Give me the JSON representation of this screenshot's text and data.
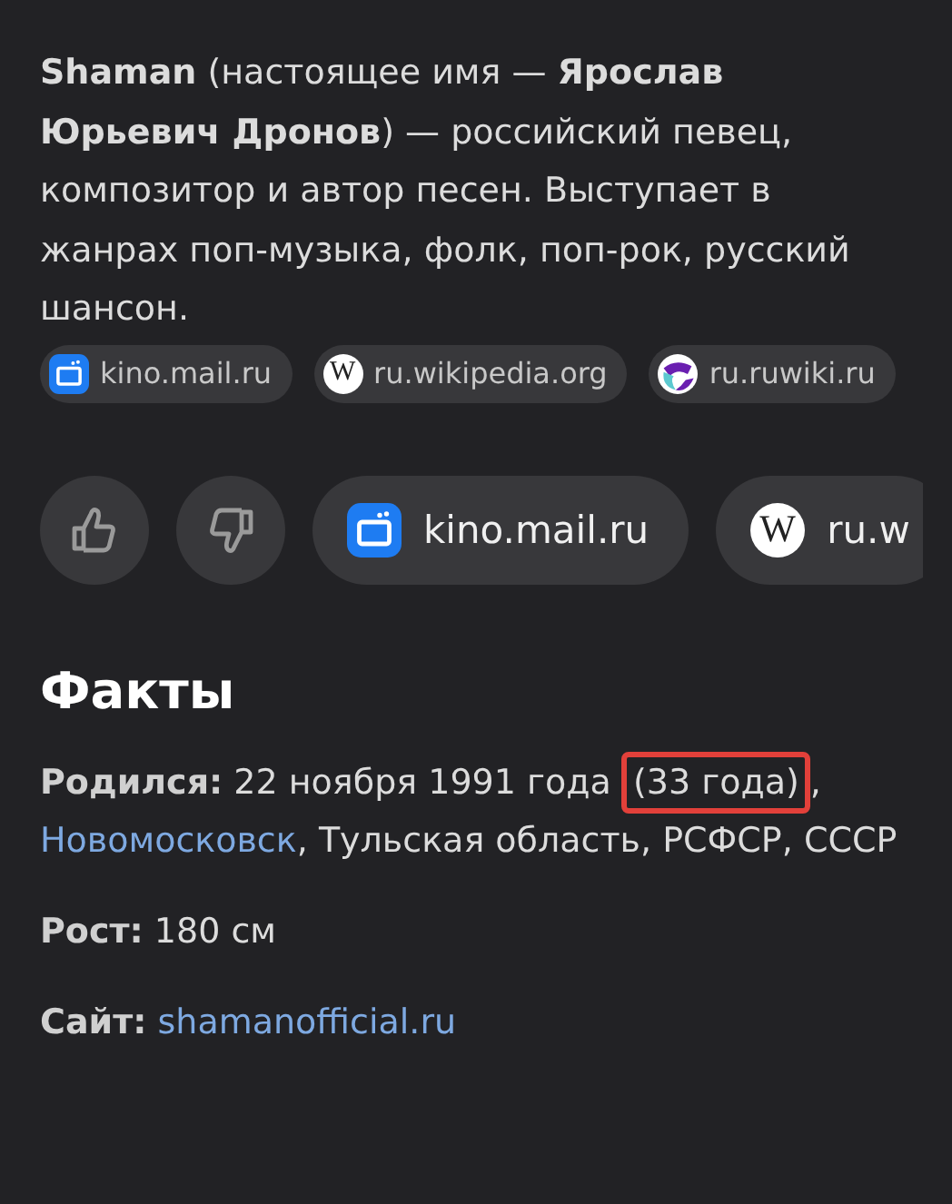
{
  "description": "**Shaman** (настоящее имя — **Ярослав Юрьевич Дронов**) — российский певец, композитор и автор песен. Выступает в жанрах поп-музыка, фолк, поп-рок, русский шансон.",
  "sources": [
    {
      "label": "kino.mail.ru",
      "kind": "kino"
    },
    {
      "label": "ru.wikipedia.org",
      "kind": "wiki",
      "glyph": "W"
    },
    {
      "label": "ru.ruwiki.ru",
      "kind": "ruwiki"
    }
  ],
  "actions": {
    "feedback": [
      {
        "kind": "like"
      },
      {
        "kind": "dislike"
      }
    ],
    "links": [
      {
        "label": "kino.mail.ru",
        "kind": "kino"
      },
      {
        "label": "ru.w",
        "kind": "wiki",
        "glyph": "W"
      }
    ]
  },
  "facts": {
    "title": "Факты",
    "items": [
      {
        "label": "Родился:",
        "parts": [
          {
            "kind": "plain",
            "text": "22 ноября 1991 года"
          },
          {
            "kind": "highlight",
            "text": "(33 года)"
          },
          {
            "kind": "plain",
            "text": ","
          },
          {
            "kind": "link",
            "text": "Новомосковск"
          },
          {
            "kind": "plain",
            "text": ", Тульская область, РСФСР, СССР"
          }
        ]
      },
      {
        "label": "Рост:",
        "parts": [
          {
            "kind": "plain",
            "text": "180 см"
          }
        ]
      },
      {
        "label": "Сайт:",
        "parts": [
          {
            "kind": "link",
            "text": "shamanofficial.ru"
          }
        ]
      }
    ]
  }
}
